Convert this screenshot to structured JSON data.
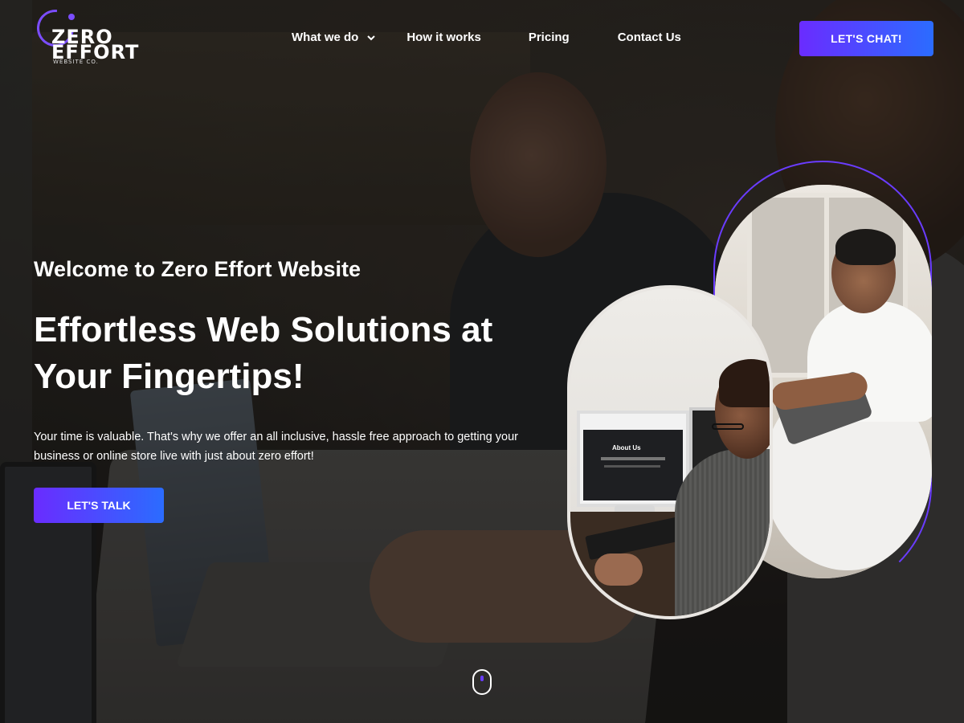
{
  "brand": {
    "line1": "ZERO",
    "line2": "EFFORT",
    "sub": "WEBSITE CO.",
    "accent": "#6a2cff",
    "accent2": "#2b6cff"
  },
  "nav": {
    "items": [
      {
        "label": "What we do",
        "has_dropdown": true
      },
      {
        "label": "How it works",
        "has_dropdown": false
      },
      {
        "label": "Pricing",
        "has_dropdown": false
      },
      {
        "label": "Contact Us",
        "has_dropdown": false
      }
    ],
    "cta": "LET'S CHAT!"
  },
  "hero": {
    "welcome": "Welcome to Zero Effort Website",
    "headline": "Effortless Web Solutions at Your Fingertips!",
    "description": "Your time is valuable. That's why we offer an all inclusive, hassle free approach to getting your business or online store live with just about zero effort!",
    "cta": "LET'S TALK"
  },
  "images": {
    "front_screen_text": "About Us"
  },
  "icons": {
    "dropdown": "chevron-down-icon",
    "scroll": "mouse-scroll-icon"
  }
}
